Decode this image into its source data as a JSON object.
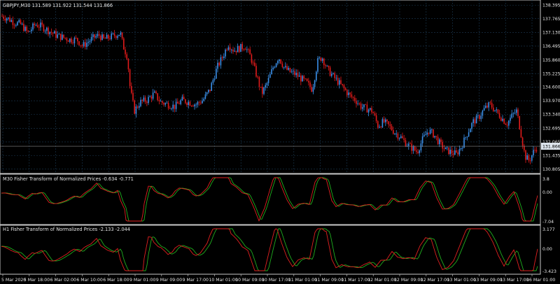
{
  "main_panel": {
    "title": "GBPJPY,M30  131.589 131.922 131.544 131.866",
    "price_labels": [
      "138.395",
      "137.765",
      "137.130",
      "136.495",
      "135.860",
      "135.225",
      "134.600",
      "133.970",
      "133.340",
      "132.695",
      "132.065",
      "131.435",
      "130.805"
    ],
    "current_price": "131.866",
    "colors": {
      "bull": "#3a8fe8",
      "bear": "#e01b1b",
      "current_box": "#dfe6ee"
    }
  },
  "indicator1": {
    "title": "M30 Fisher Transform of Normalized Prices -0.634 -0.771",
    "labels": [
      "3.8",
      "0.00",
      "-7.04"
    ]
  },
  "indicator2": {
    "title": "H1 Fisher Transform of Normalized Prices -2.133 -2.044",
    "labels": [
      "3.177",
      "0.00",
      "-3.423"
    ]
  },
  "time_labels": [
    "5 Mar 2020",
    "5 Mar 18:00",
    "6 Mar 02:00",
    "6 Mar 10:00",
    "6 Mar 18:00",
    "9 Mar 01:00",
    "9 Mar 09:00",
    "9 Mar 17:00",
    "10 Mar 01:00",
    "10 Mar 09:00",
    "10 Mar 17:00",
    "11 Mar 01:00",
    "11 Mar 09:00",
    "11 Mar 17:00",
    "12 Mar 01:00",
    "12 Mar 09:00",
    "12 Mar 17:00",
    "13 Mar 01:00",
    "13 Mar 09:00",
    "13 Mar 17:00",
    "16 Mar 01:00"
  ],
  "chart_data": {
    "type": "candlestick",
    "symbol": "GBPJPY",
    "timeframe": "M30",
    "ylim": [
      130.8,
      138.5
    ],
    "close_path": [
      {
        "x": 0,
        "y": 137.9
      },
      {
        "x": 10,
        "y": 137.8
      },
      {
        "x": 20,
        "y": 137.6
      },
      {
        "x": 30,
        "y": 137.5
      },
      {
        "x": 40,
        "y": 137.1
      },
      {
        "x": 50,
        "y": 137.5
      },
      {
        "x": 60,
        "y": 137.4
      },
      {
        "x": 70,
        "y": 137.2
      },
      {
        "x": 80,
        "y": 137.0
      },
      {
        "x": 90,
        "y": 136.9
      },
      {
        "x": 100,
        "y": 136.8
      },
      {
        "x": 110,
        "y": 136.8
      },
      {
        "x": 118,
        "y": 136.5
      },
      {
        "x": 126,
        "y": 136.7
      },
      {
        "x": 134,
        "y": 136.9
      },
      {
        "x": 142,
        "y": 137.0
      },
      {
        "x": 148,
        "y": 136.8
      },
      {
        "x": 156,
        "y": 136.9
      },
      {
        "x": 164,
        "y": 137.0
      },
      {
        "x": 172,
        "y": 137.1
      },
      {
        "x": 176,
        "y": 136.5
      },
      {
        "x": 182,
        "y": 136.0
      },
      {
        "x": 186,
        "y": 134.5
      },
      {
        "x": 192,
        "y": 133.5
      },
      {
        "x": 200,
        "y": 133.9
      },
      {
        "x": 210,
        "y": 134.0
      },
      {
        "x": 220,
        "y": 134.3
      },
      {
        "x": 230,
        "y": 133.9
      },
      {
        "x": 240,
        "y": 133.8
      },
      {
        "x": 250,
        "y": 133.7
      },
      {
        "x": 260,
        "y": 134.0
      },
      {
        "x": 270,
        "y": 133.9
      },
      {
        "x": 280,
        "y": 133.8
      },
      {
        "x": 290,
        "y": 134.0
      },
      {
        "x": 300,
        "y": 134.5
      },
      {
        "x": 310,
        "y": 135.5
      },
      {
        "x": 318,
        "y": 136.0
      },
      {
        "x": 326,
        "y": 136.6
      },
      {
        "x": 334,
        "y": 136.3
      },
      {
        "x": 342,
        "y": 136.4
      },
      {
        "x": 350,
        "y": 136.5
      },
      {
        "x": 358,
        "y": 136.0
      },
      {
        "x": 366,
        "y": 135.2
      },
      {
        "x": 374,
        "y": 134.3
      },
      {
        "x": 382,
        "y": 134.8
      },
      {
        "x": 390,
        "y": 135.5
      },
      {
        "x": 398,
        "y": 136.0
      },
      {
        "x": 406,
        "y": 135.5
      },
      {
        "x": 414,
        "y": 135.3
      },
      {
        "x": 422,
        "y": 135.2
      },
      {
        "x": 430,
        "y": 135.0
      },
      {
        "x": 438,
        "y": 134.8
      },
      {
        "x": 446,
        "y": 134.5
      },
      {
        "x": 454,
        "y": 135.8
      },
      {
        "x": 460,
        "y": 136.0
      },
      {
        "x": 468,
        "y": 135.4
      },
      {
        "x": 476,
        "y": 135.1
      },
      {
        "x": 484,
        "y": 134.8
      },
      {
        "x": 492,
        "y": 134.5
      },
      {
        "x": 500,
        "y": 134.2
      },
      {
        "x": 508,
        "y": 134.0
      },
      {
        "x": 516,
        "y": 133.7
      },
      {
        "x": 524,
        "y": 133.6
      },
      {
        "x": 532,
        "y": 133.5
      },
      {
        "x": 540,
        "y": 132.8
      },
      {
        "x": 548,
        "y": 133.0
      },
      {
        "x": 556,
        "y": 132.8
      },
      {
        "x": 564,
        "y": 132.5
      },
      {
        "x": 572,
        "y": 132.3
      },
      {
        "x": 580,
        "y": 132.0
      },
      {
        "x": 588,
        "y": 131.8
      },
      {
        "x": 596,
        "y": 131.6
      },
      {
        "x": 604,
        "y": 132.2
      },
      {
        "x": 612,
        "y": 132.6
      },
      {
        "x": 620,
        "y": 132.4
      },
      {
        "x": 628,
        "y": 132.0
      },
      {
        "x": 636,
        "y": 131.7
      },
      {
        "x": 644,
        "y": 131.6
      },
      {
        "x": 652,
        "y": 131.5
      },
      {
        "x": 660,
        "y": 131.9
      },
      {
        "x": 668,
        "y": 132.5
      },
      {
        "x": 676,
        "y": 133.0
      },
      {
        "x": 684,
        "y": 133.2
      },
      {
        "x": 692,
        "y": 133.6
      },
      {
        "x": 700,
        "y": 133.8
      },
      {
        "x": 708,
        "y": 133.5
      },
      {
        "x": 716,
        "y": 133.2
      },
      {
        "x": 724,
        "y": 132.9
      },
      {
        "x": 732,
        "y": 133.3
      },
      {
        "x": 738,
        "y": 133.5
      },
      {
        "x": 744,
        "y": 132.5
      },
      {
        "x": 750,
        "y": 131.4
      },
      {
        "x": 756,
        "y": 131.2
      },
      {
        "x": 762,
        "y": 131.6
      },
      {
        "x": 768,
        "y": 131.87
      }
    ]
  }
}
